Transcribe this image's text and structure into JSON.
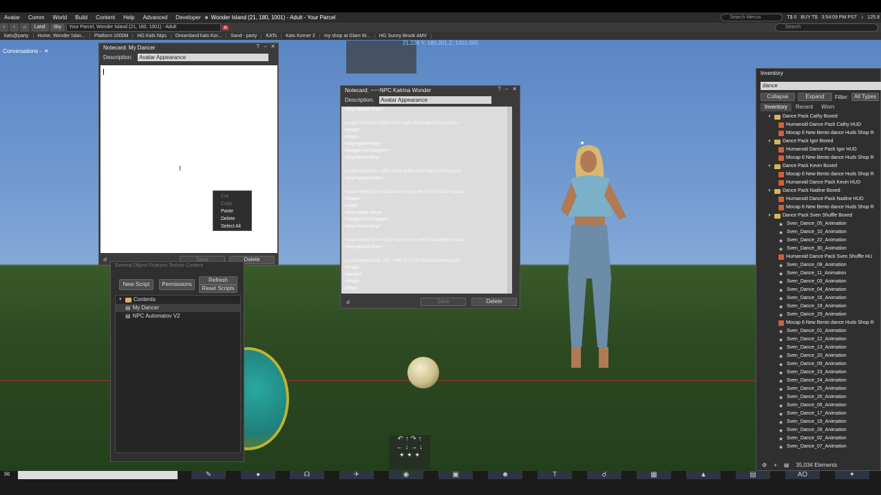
{
  "menubar": {
    "items": [
      "Avatar",
      "Comm",
      "World",
      "Build",
      "Content",
      "Help",
      "Advanced",
      "Developer"
    ],
    "location": "Wonder Island (21, 180, 1001) - Adult - Your Parcel",
    "search_placeholder": "Search Menus",
    "balance": "T$ 0",
    "buy": "BUY T$",
    "time": "3:54:09 PM PST",
    "fps": "125.8"
  },
  "navbar": {
    "land": "Land",
    "sky": "Sky",
    "url": "Your Parcel, Wonder Island (21, 180, 1001) - Adult",
    "search_placeholder": "Search"
  },
  "favorites": [
    "kats@party",
    "Home, Wonder Islan...",
    "Platform 1000M",
    "HG Kats Nips",
    "Dreamland kats Kor...",
    "Sand - party",
    "KATs",
    "Kats Korner 2",
    "my shop at Glam W...",
    "HG Sunny Brook AMV"
  ],
  "conversations": {
    "title": "Conversations -"
  },
  "notecard1": {
    "title": "Notecard: My Dancer",
    "desc_label": "Description:",
    "desc_value": "Avatar Appearance",
    "save": "Save",
    "delete": "Delete"
  },
  "context_menu": {
    "items": [
      {
        "label": "Cut",
        "enabled": false
      },
      {
        "label": "Copy",
        "enabled": false
      },
      {
        "label": "Paste",
        "enabled": true
      },
      {
        "label": "Delete",
        "enabled": true
      },
      {
        "label": "Select All",
        "enabled": true
      }
    ]
  },
  "notecard2": {
    "title": "Notecard: ~~~NPC Katrina Wonder",
    "desc_label": "Description:",
    "desc_value": "Avatar Appearance",
    "save": "Save",
    "delete": "Delete",
    "lines": [
      "        <key>asset</key>",
      "",
      "<uuid>7cf945fc-635d-47f6-bafe-2bfde48337fe</uuid>",
      "      </map>",
      "      <map>",
      "        <key>point</key>",
      "        <integer>9</integer>",
      "        <key>item</key>",
      "",
      "<uuid>c634f161-af50-4e08-adb0-58878fe107c9</uuid>",
      "        <key>asset</key>",
      "",
      "<uuid>08ef21b9-83b0-4850-b9cb-98c6671d4667</uuid>",
      "      </map>",
      "      <map>",
      "        <key>point</key>",
      "        <integer>9</integer>",
      "        <key>item</key>",
      "",
      "<uuid>09ad0264-c902-46e4-9b7e-e8769450fdd6</uuid>",
      "        <key>asset</key>",
      "",
      "<uuid>be4263a8-7bf1-496f-872f-0f73d3046b5d</uuid>",
      "      </map>",
      "    </array>",
      "  </map>",
      "</llsd>"
    ]
  },
  "coords": {
    "x": "21.226",
    "y": "Y: 180.201",
    "z": "Z: 1001.000"
  },
  "object_panel": {
    "tabs": "General  Object  Features  Texture  Content",
    "new_script": "New Script",
    "permissions": "Permissions",
    "refresh": "Refresh",
    "reset_scripts": "Reset Scripts",
    "folder": "Contents",
    "items": [
      "My Dancer",
      "NPC Automatov V2"
    ]
  },
  "inventory": {
    "title": "Inventory",
    "search_value": "dance",
    "collapse": "Collapse",
    "expand": "Expand",
    "filter": "Filter:",
    "all_types": "All Types",
    "tabs": [
      "Inventory",
      "Recent",
      "Worn"
    ],
    "items": [
      {
        "kind": "folder",
        "label": "Dance Pack Cathy Boxed"
      },
      {
        "kind": "obj",
        "label": "Humanoid Dance Pack Cathy HUD"
      },
      {
        "kind": "obj",
        "label": "Mocap 6 New Bento dance Huds Shop R"
      },
      {
        "kind": "folder",
        "label": "Dance Pack Igor Boxed"
      },
      {
        "kind": "obj",
        "label": "Humanoid Dance Pack Igor HUD"
      },
      {
        "kind": "obj",
        "label": "Mocap 6 New Bento dance Huds Shop R"
      },
      {
        "kind": "folder",
        "label": "Dance Pack Kevin Boxed"
      },
      {
        "kind": "obj",
        "label": "Mocap 6 New Bento dance Huds Shop R"
      },
      {
        "kind": "obj",
        "label": "Humanoid Dance Pack Kevin HUD"
      },
      {
        "kind": "folder",
        "label": "Dance Pack Nadine Boxed"
      },
      {
        "kind": "obj",
        "label": "Humanoid Dance Pack Nadine HUD"
      },
      {
        "kind": "obj",
        "label": "Mocap 6 New Bento dance Huds Shop R"
      },
      {
        "kind": "folder",
        "label": "Dance Pack Sven Shuffle Boxed"
      },
      {
        "kind": "anim",
        "label": "Sven_Dance_05_Animation"
      },
      {
        "kind": "anim",
        "label": "Sven_Dance_10_Animation"
      },
      {
        "kind": "anim",
        "label": "Sven_Dance_22_Animation"
      },
      {
        "kind": "anim",
        "label": "Sven_Dance_30_Animation"
      },
      {
        "kind": "obj",
        "label": "Humanoid Dance Pack Sven Shuffle HU"
      },
      {
        "kind": "anim",
        "label": "Sven_Dance_08_Animation"
      },
      {
        "kind": "anim",
        "label": "Sven_Dance_11_Animation"
      },
      {
        "kind": "anim",
        "label": "Sven_Dance_03_Animation"
      },
      {
        "kind": "anim",
        "label": "Sven_Dance_04_Animation"
      },
      {
        "kind": "anim",
        "label": "Sven_Dance_16_Animation"
      },
      {
        "kind": "anim",
        "label": "Sven_Dance_18_Animation"
      },
      {
        "kind": "anim",
        "label": "Sven_Dance_29_Animation"
      },
      {
        "kind": "obj",
        "label": "Mocap 6 New Bento dance Huds Shop R"
      },
      {
        "kind": "anim",
        "label": "Sven_Dance_01_Animation"
      },
      {
        "kind": "anim",
        "label": "Sven_Dance_12_Animation"
      },
      {
        "kind": "anim",
        "label": "Sven_Dance_13_Animation"
      },
      {
        "kind": "anim",
        "label": "Sven_Dance_20_Animation"
      },
      {
        "kind": "anim",
        "label": "Sven_Dance_09_Animation"
      },
      {
        "kind": "anim",
        "label": "Sven_Dance_23_Animation"
      },
      {
        "kind": "anim",
        "label": "Sven_Dance_24_Animation"
      },
      {
        "kind": "anim",
        "label": "Sven_Dance_25_Animation"
      },
      {
        "kind": "anim",
        "label": "Sven_Dance_26_Animation"
      },
      {
        "kind": "anim",
        "label": "Sven_Dance_06_Animation"
      },
      {
        "kind": "anim",
        "label": "Sven_Dance_17_Animation"
      },
      {
        "kind": "anim",
        "label": "Sven_Dance_19_Animation"
      },
      {
        "kind": "anim",
        "label": "Sven_Dance_28_Animation"
      },
      {
        "kind": "anim",
        "label": "Sven_Dance_02_Animation"
      },
      {
        "kind": "anim",
        "label": "Sven_Dance_07_Animation"
      }
    ],
    "count": "35,034 Elements"
  },
  "bottombar": {
    "ao": "AO"
  }
}
